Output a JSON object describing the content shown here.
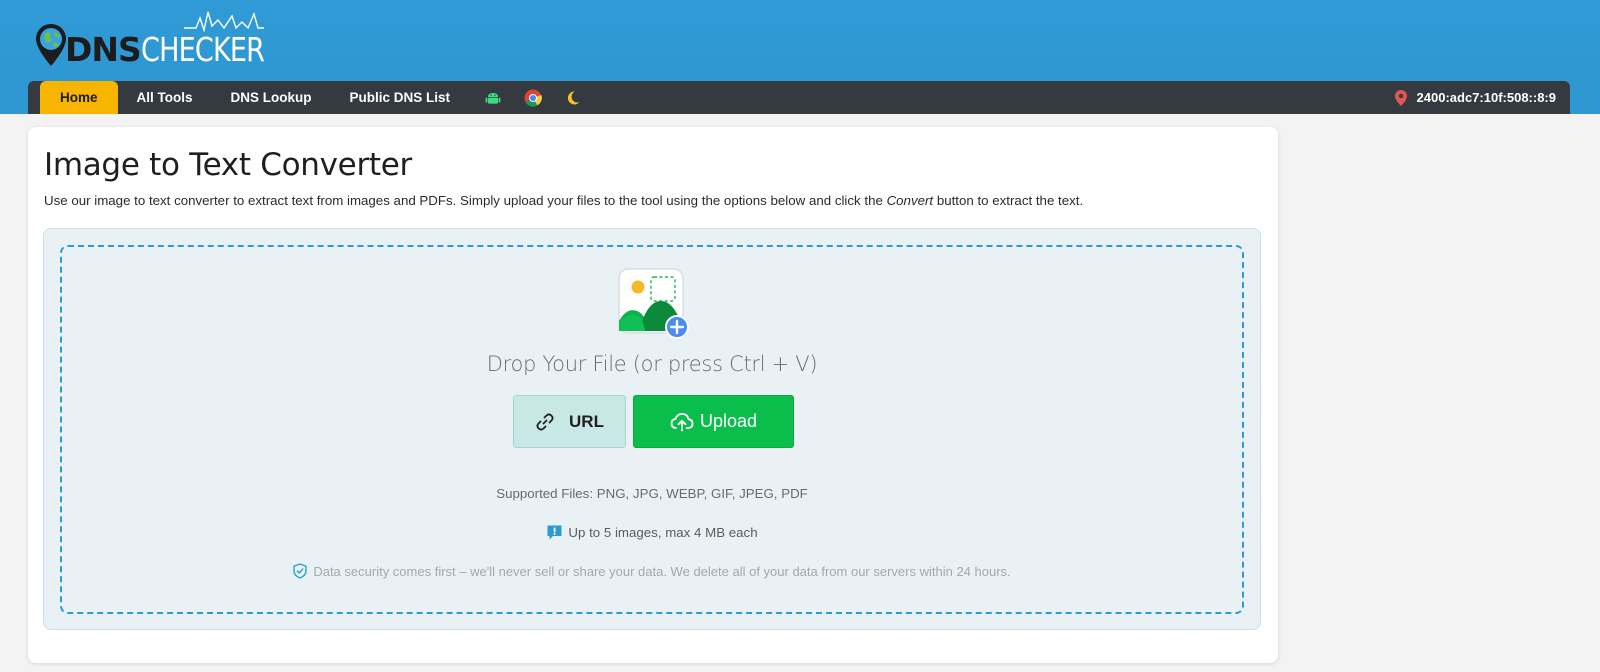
{
  "header": {
    "logo": {
      "part1": "DNS",
      "part2": "CHECKER"
    }
  },
  "nav": {
    "items": [
      "Home",
      "All Tools",
      "DNS Lookup",
      "Public DNS List"
    ],
    "icons": [
      "android-icon",
      "chrome-icon",
      "moon-icon"
    ],
    "ip_address": "2400:adc7:10f:508::8:9"
  },
  "main": {
    "title": "Image to Text Converter",
    "description_before": "Use our image to text converter to extract text from images and PDFs. Simply upload your files to the tool using the options below and click the ",
    "description_em": "Convert",
    "description_after": " button to extract the text.",
    "drop_text": "Drop Your File (or press Ctrl + V)",
    "url_button": "URL",
    "upload_button": "Upload",
    "supported_files": "Supported Files: PNG, JPG, WEBP, GIF, JPEG, PDF",
    "limit_text": "Up to 5 images, max 4 MB each",
    "security_text": "Data security comes first – we'll never sell or share your data. We delete all of your data from our servers within 24 hours."
  },
  "colors": {
    "header_bg": "#2f9ad6",
    "nav_bg": "#343a40",
    "nav_active": "#f7b500",
    "upload_green": "#0bbe4c",
    "url_bg": "#c8e8e5",
    "dropzone_border": "#2b9bd3"
  }
}
